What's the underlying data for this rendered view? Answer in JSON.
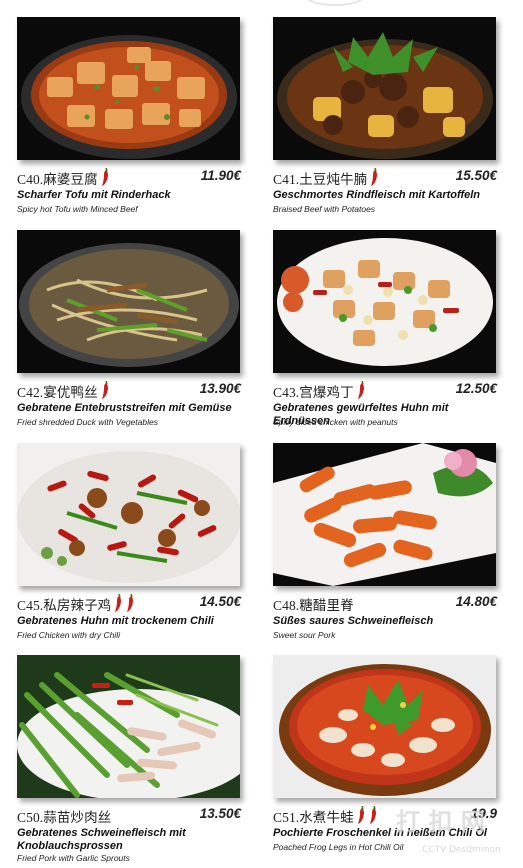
{
  "items": [
    {
      "code": "C40.麻婆豆腐",
      "chili_count": 1,
      "price": "11.90€",
      "name_de": "Scharfer Tofu mit Rinderhack",
      "name_en": "Spicy hot Tofu with Minced Beef",
      "photo": "mapo-tofu-photo"
    },
    {
      "code": "C41.土豆炖牛腩",
      "chili_count": 1,
      "price": "15.50€",
      "name_de": "Geschmortes Rindfleisch mit Kartoffeln",
      "name_en": "Braised Beef with Potatoes",
      "photo": "beef-potato-stew-photo"
    },
    {
      "code": "C42.宴优鸭丝",
      "chili_count": 1,
      "price": "13.90€",
      "name_de": "Gebratene Entebruststreifen mit Gemüse",
      "name_en": "Fried shredded Duck with Vegetables",
      "photo": "shredded-duck-photo"
    },
    {
      "code": "C43.宫爆鸡丁",
      "chili_count": 1,
      "price": "12.50€",
      "name_de": "Gebratenes gewürfeltes Huhn mit Erdnüssen",
      "name_en": "Spicy diced chicken with peanuts",
      "photo": "kung-pao-chicken-photo"
    },
    {
      "code": "C45.私房辣子鸡",
      "chili_count": 2,
      "price": "14.50€",
      "name_de": "Gebratenes Huhn mit trockenem Chili",
      "name_en": "Fried Chicken with dry Chili",
      "photo": "dry-chili-chicken-photo"
    },
    {
      "code": "C48.糖醋里脊",
      "chili_count": 0,
      "price": "14.80€",
      "name_de": "Süßes saures Schweinefleisch",
      "name_en": "Sweet sour Pork",
      "photo": "sweet-sour-pork-photo"
    },
    {
      "code": "C50.蒜苗炒肉丝",
      "chili_count": 0,
      "price": "13.50€",
      "name_de": "Gebratenes Schweinefleisch mit Knoblauchsprossen",
      "name_en": "Fried Pork with Garlic Sprouts",
      "photo": "pork-garlic-sprouts-photo"
    },
    {
      "code": "C51.水煮牛蛙",
      "chili_count": 2,
      "price": "19.9",
      "name_de": "Pochierte Froschenkel in heißem Chili Öl",
      "name_en": "Poached Frog Legs in Hot Chili Oil",
      "photo": "frog-legs-chili-oil-photo"
    }
  ],
  "watermark": {
    "text": "打 扣 网",
    "subtext": "CCTV Desdmmon"
  },
  "colors": {
    "chili": "#c8201a",
    "text": "#1a1a1a",
    "shadow": "#555555"
  }
}
